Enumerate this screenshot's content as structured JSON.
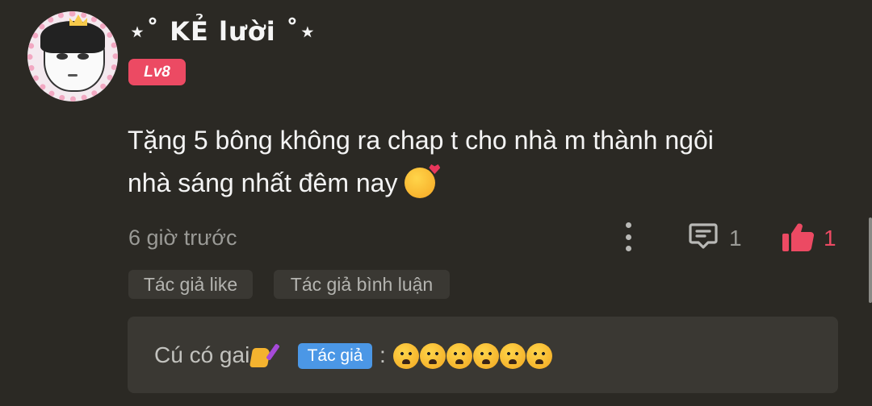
{
  "user": {
    "name": "⋆˚ KẺ lười ˚⋆",
    "level": "Lv8"
  },
  "comment": {
    "text_line1": "Tặng 5 bông không ra chap t cho nhà m thành ngôi",
    "text_line2": "nhà sáng nhất đêm nay",
    "emoji": "smiling-face-with-hearts"
  },
  "meta": {
    "time": "6 giờ trước",
    "reply_count": "1",
    "like_count": "1",
    "like_color": "#ec4a63"
  },
  "tags": {
    "author_liked": "Tác giả like",
    "author_replied": "Tác giả bình luận"
  },
  "reply": {
    "author": "Cú có gai",
    "author_emoji": "nail-polish",
    "author_badge": "Tác giả",
    "colon": ":",
    "emojis": [
      "worried-face",
      "worried-face",
      "worried-face",
      "worried-face",
      "worried-face",
      "worried-face"
    ],
    "badge_color": "#4b97e6"
  }
}
